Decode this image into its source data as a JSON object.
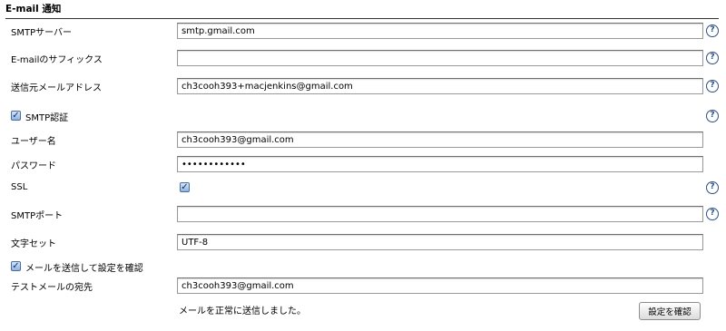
{
  "section": {
    "title": "E-mail 通知"
  },
  "fields": {
    "smtp_server": {
      "label": "SMTPサーバー",
      "value": "smtp.gmail.com"
    },
    "email_suffix": {
      "label": "E-mailのサフィックス",
      "value": ""
    },
    "sender_address": {
      "label": "送信元メールアドレス",
      "value": "ch3cooh393+macjenkins@gmail.com"
    },
    "smtp_auth": {
      "label": "SMTP認証",
      "checked": true
    },
    "username": {
      "label": "ユーザー名",
      "value": "ch3cooh393@gmail.com"
    },
    "password": {
      "label": "パスワード",
      "value": "••••••••••••"
    },
    "ssl": {
      "label": "SSL",
      "checked": true
    },
    "smtp_port": {
      "label": "SMTPポート",
      "value": ""
    },
    "charset": {
      "label": "文字セット",
      "value": "UTF-8"
    },
    "test_send": {
      "label": "メールを送信して設定を確認",
      "checked": true
    },
    "test_recipient": {
      "label": "テストメールの宛先",
      "value": "ch3cooh393@gmail.com"
    }
  },
  "status": {
    "message": "メールを正常に送信しました。"
  },
  "buttons": {
    "verify_label": "設定を確認"
  },
  "icons": {
    "help": "help-icon",
    "checkbox_check": "check-icon"
  },
  "colors": {
    "help_icon": "#2c4f86",
    "checkbox": "#8fb3e0"
  }
}
